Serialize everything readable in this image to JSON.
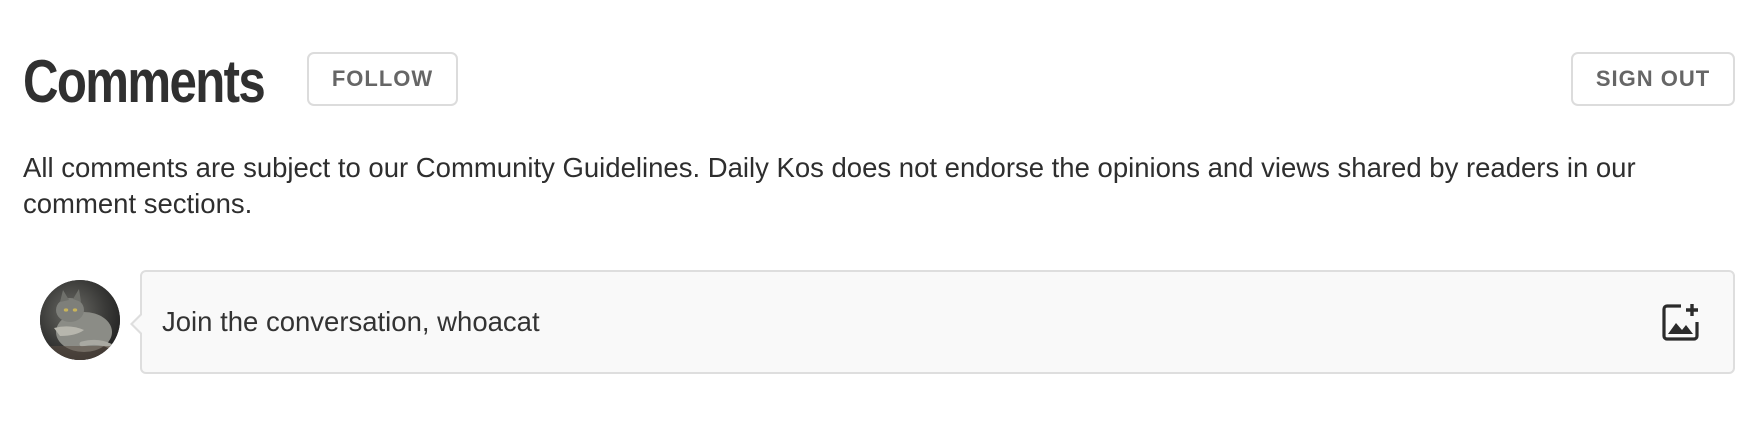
{
  "comments": {
    "title": "Comments",
    "follow_label": "FOLLOW",
    "sign_out_label": "SIGN OUT",
    "guidelines_text": "All comments are subject to our Community Guidelines. Daily Kos does not endorse the opinions and views shared by readers in our comment sections."
  },
  "composer": {
    "placeholder": "Join the conversation, whoacat",
    "avatar_icon": "cat-avatar",
    "image_icon": "add-image-icon"
  },
  "colors": {
    "title": "#303030",
    "button_text": "#666666",
    "button_border": "#dcdcdc",
    "composer_background": "#f9f9f9",
    "composer_border": "#dedede"
  }
}
